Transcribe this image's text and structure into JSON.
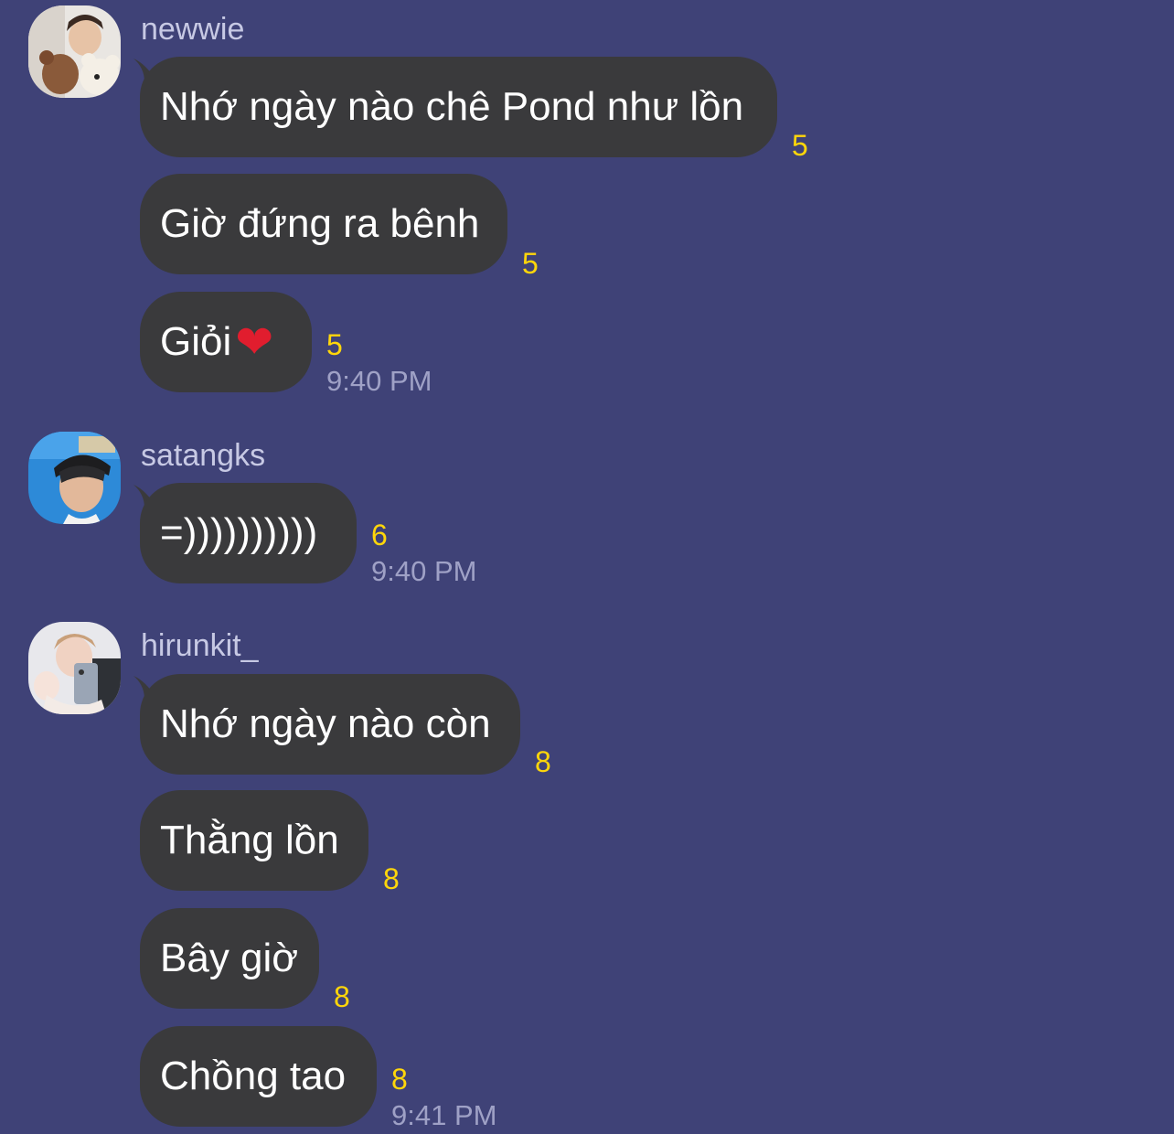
{
  "groups": [
    {
      "sender": "newwie",
      "avatar_icon": "avatar-newwie",
      "messages": [
        {
          "text": "Nhớ ngày nào chê Pond như lồn",
          "read": "5"
        },
        {
          "text": "Giờ đứng ra bênh",
          "read": "5"
        },
        {
          "text": "Giỏi",
          "emoji": "❤",
          "read": "5"
        }
      ],
      "time": "9:40 PM"
    },
    {
      "sender": "satangks",
      "avatar_icon": "avatar-satangks",
      "messages": [
        {
          "text": "=))))))))))",
          "read": "6"
        }
      ],
      "time": "9:40 PM"
    },
    {
      "sender": "hirunkit_",
      "avatar_icon": "avatar-hirunkit",
      "messages": [
        {
          "text": "Nhớ ngày nào còn",
          "read": "8"
        },
        {
          "text": "Thằng lồn",
          "read": "8"
        },
        {
          "text": "Bây giờ",
          "read": "8"
        },
        {
          "text": "Chồng tao",
          "read": "8"
        }
      ],
      "time": "9:41 PM"
    }
  ],
  "colors": {
    "background": "#3f4277",
    "bubble": "#3a3a3c",
    "read_count": "#ffd60a",
    "timestamp": "#9fa1c6"
  }
}
